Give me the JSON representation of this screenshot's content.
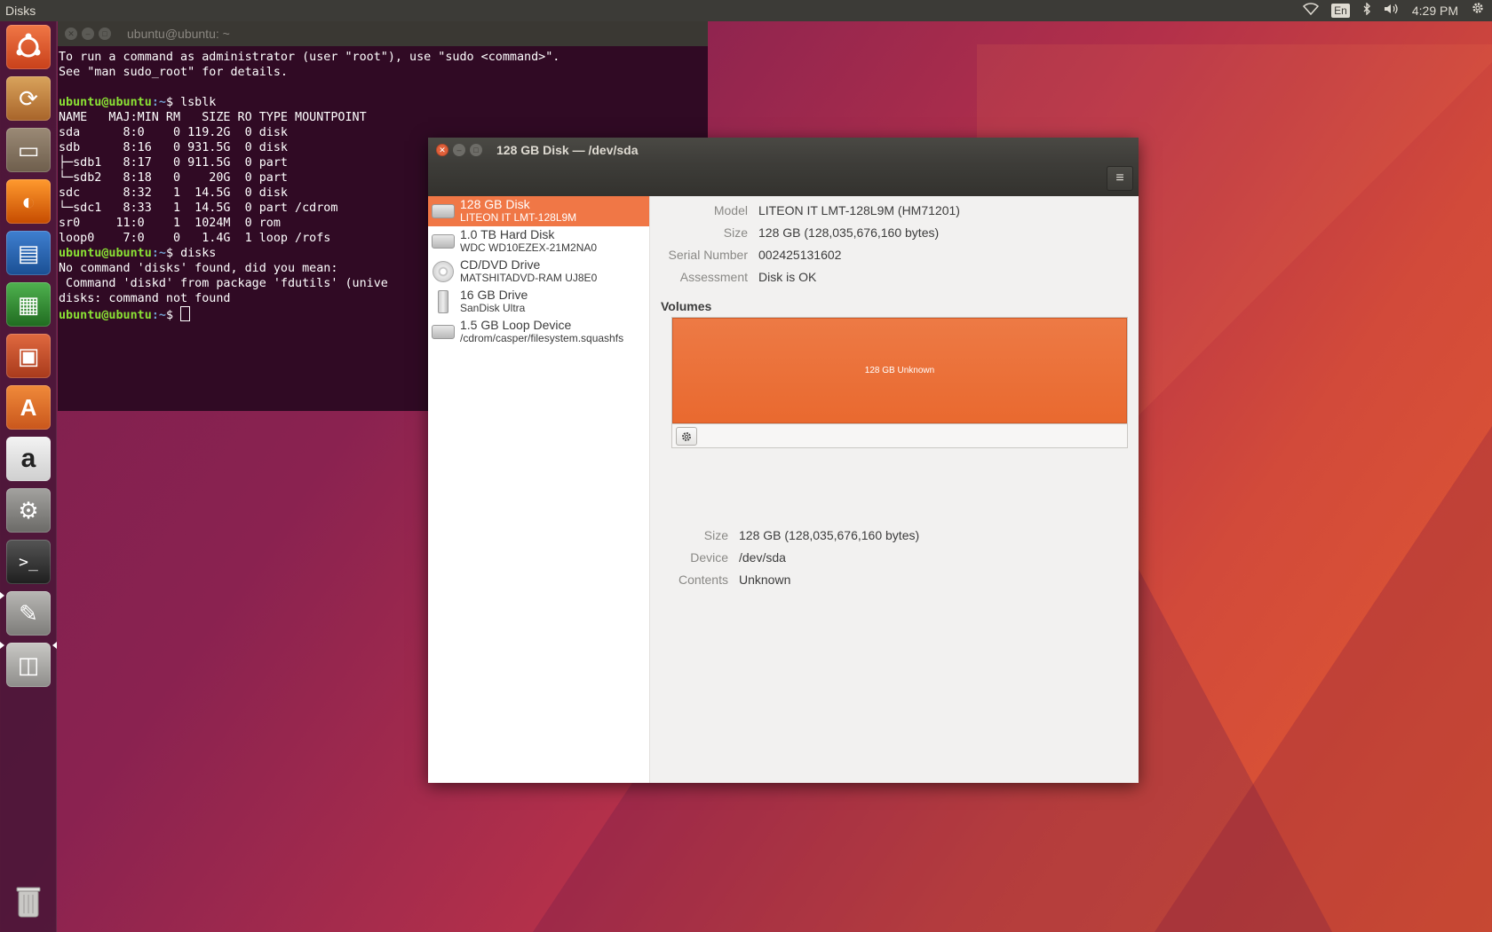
{
  "top_panel": {
    "app_name": "Disks",
    "lang": "En",
    "clock": "4:29 PM",
    "icons": [
      "wifi-icon",
      "bluetooth-icon",
      "volume-icon",
      "settings-gear-icon"
    ]
  },
  "launcher": {
    "items": [
      {
        "name": "ubuntu-dash",
        "glyph": "◉",
        "color": "#e95420"
      },
      {
        "name": "software-updater",
        "glyph": "⟳",
        "color": "#c97d3a"
      },
      {
        "name": "files",
        "glyph": "▭",
        "color": "#7a6a58"
      },
      {
        "name": "firefox",
        "glyph": "◐",
        "color": "#e66000"
      },
      {
        "name": "libreoffice-writer",
        "glyph": "▤",
        "color": "#1f5fa8"
      },
      {
        "name": "libreoffice-calc",
        "glyph": "▦",
        "color": "#2d8a2d"
      },
      {
        "name": "libreoffice-impress",
        "glyph": "▣",
        "color": "#c0462a"
      },
      {
        "name": "ubuntu-software",
        "glyph": "A",
        "color": "#e26c28"
      },
      {
        "name": "amazon",
        "glyph": "a",
        "color": "#1a1a1a"
      },
      {
        "name": "system-settings",
        "glyph": "⚙",
        "color": "#7d7c79"
      },
      {
        "name": "terminal",
        "glyph": ">_",
        "color": "#2c2c2c"
      },
      {
        "name": "disks-tools",
        "glyph": "✎",
        "color": "#8e8d8a"
      },
      {
        "name": "disks",
        "glyph": "◫",
        "color": "#9a9996"
      }
    ],
    "trash_glyph": "🗑"
  },
  "terminal": {
    "title": "ubuntu@ubuntu: ~",
    "lines": [
      "To run a command as administrator (user \"root\"), use \"sudo <command>\".",
      "See \"man sudo_root\" for details.",
      "",
      "NAME   MAJ:MIN RM   SIZE RO TYPE MOUNTPOINT",
      "sda      8:0    0 119.2G  0 disk",
      "sdb      8:16   0 931.5G  0 disk",
      "├─sdb1   8:17   0 911.5G  0 part",
      "└─sdb2   8:18   0    20G  0 part",
      "sdc      8:32   1  14.5G  0 disk",
      "└─sdc1   8:33   1  14.5G  0 part /cdrom",
      "sr0     11:0    1  1024M  0 rom",
      "loop0    7:0    0   1.4G  1 loop /rofs",
      "No command 'disks' found, did you mean:",
      " Command 'diskd' from package 'fdutils' (unive",
      "disks: command not found"
    ],
    "prompt_user": "ubuntu@ubuntu",
    "prompt_path": ":~",
    "prompt_sym": "$ ",
    "cmd1": "lsblk",
    "cmd2": "disks"
  },
  "disks_window": {
    "title": "128 GB Disk — /dev/sda",
    "menu_glyph": "≡",
    "devices": [
      {
        "name": "128 GB Disk",
        "sub": "LITEON IT LMT-128L9M",
        "kind": "hdd",
        "selected": true
      },
      {
        "name": "1.0 TB Hard Disk",
        "sub": "WDC WD10EZEX-21M2NA0",
        "kind": "hdd",
        "selected": false
      },
      {
        "name": "CD/DVD Drive",
        "sub": "MATSHITADVD-RAM UJ8E0",
        "kind": "cd",
        "selected": false
      },
      {
        "name": "16 GB Drive",
        "sub": "SanDisk Ultra",
        "kind": "usb",
        "selected": false
      },
      {
        "name": "1.5 GB Loop Device",
        "sub": "/cdrom/casper/filesystem.squashfs",
        "kind": "hdd",
        "selected": false
      }
    ],
    "drive_info": {
      "model_label": "Model",
      "model": "LITEON IT LMT-128L9M (HM71201)",
      "size_label": "Size",
      "size": "128 GB (128,035,676,160 bytes)",
      "serial_label": "Serial Number",
      "serial": "002425131602",
      "assessment_label": "Assessment",
      "assessment": "Disk is OK"
    },
    "volumes_heading": "Volumes",
    "partition_label": "128 GB Unknown",
    "volume_info": {
      "size_label": "Size",
      "size": "128 GB (128,035,676,160 bytes)",
      "device_label": "Device",
      "device": "/dev/sda",
      "contents_label": "Contents",
      "contents": "Unknown"
    }
  }
}
